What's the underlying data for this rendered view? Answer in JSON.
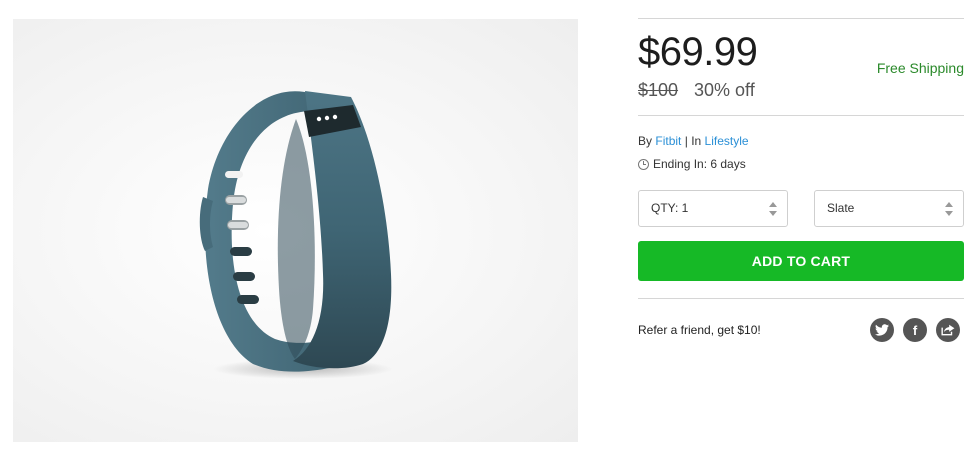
{
  "product": {
    "price": "$69.99",
    "old_price": "$100",
    "discount": "30% off",
    "shipping": "Free Shipping",
    "by_label": "By",
    "brand": "Fitbit",
    "separator": "|",
    "in_label": "In",
    "category": "Lifestyle",
    "ending": "Ending In: 6 days"
  },
  "options": {
    "qty_value": "QTY: 1",
    "color_value": "Slate"
  },
  "actions": {
    "add_to_cart": "ADD TO CART"
  },
  "referral": {
    "text": "Refer a friend, get $10!"
  },
  "social": {
    "twitter_icon": "twitter-icon",
    "facebook_icon": "facebook-icon",
    "share_icon": "share-icon",
    "facebook_glyph": "f"
  },
  "colors": {
    "accent_green": "#16b926",
    "shipping_green": "#2b8a2b",
    "link_blue": "#2a8fd6",
    "band_slate": "#3e6272"
  }
}
